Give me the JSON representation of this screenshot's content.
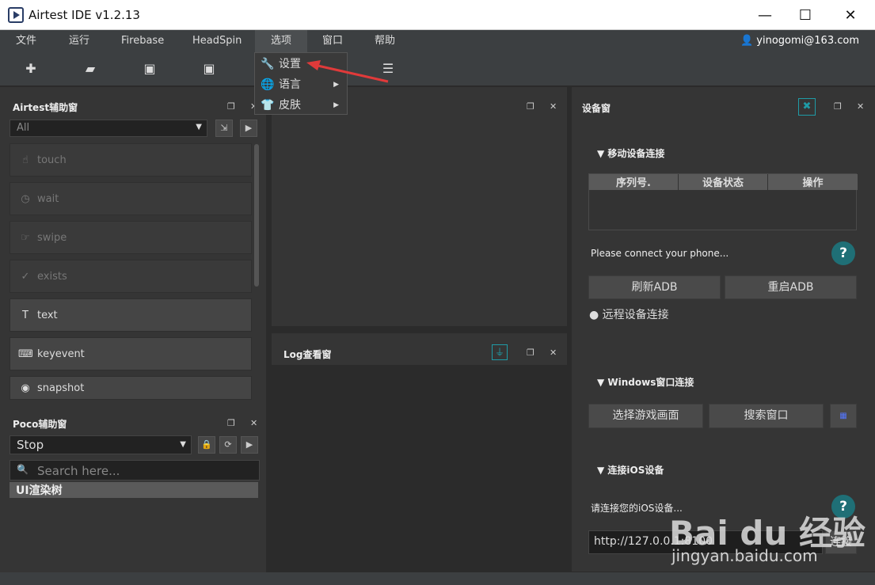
{
  "app": {
    "title": "Airtest IDE v1.2.13"
  },
  "window_controls": [
    "—",
    "☐",
    "✕"
  ],
  "menubar": {
    "items": [
      "文件",
      "运行",
      "Firebase",
      "HeadSpin",
      "选项",
      "窗口",
      "帮助"
    ],
    "user": "yinogomi@163.com"
  },
  "options_menu": {
    "items": [
      {
        "label": "设置",
        "icon": "wrench-icon"
      },
      {
        "label": "语言",
        "icon": "globe-icon"
      },
      {
        "label": "皮肤",
        "icon": "shirt-icon"
      }
    ]
  },
  "airtest_panel": {
    "title": "Airtest辅助窗",
    "mode": "All",
    "actions": [
      {
        "label": "touch",
        "enabled": false
      },
      {
        "label": "wait",
        "enabled": false
      },
      {
        "label": "swipe",
        "enabled": false
      },
      {
        "label": "exists",
        "enabled": false
      },
      {
        "label": "text",
        "enabled": true
      },
      {
        "label": "keyevent",
        "enabled": true
      },
      {
        "label": "snapshot",
        "enabled": true
      }
    ]
  },
  "poco_panel": {
    "title": "Poco辅助窗",
    "mode": "Stop",
    "search_placeholder": "Search here...",
    "tree_root": "UI渲染树"
  },
  "log_panel": {
    "title": "Log查看窗"
  },
  "device_panel": {
    "title": "设备窗",
    "mobile_section": "移动设备连接",
    "table_headers": [
      "序列号.",
      "设备状态",
      "操作"
    ],
    "connect_hint": "Please connect your phone...",
    "refresh_adb": "刷新ADB",
    "restart_adb": "重启ADB",
    "remote_connect": "远程设备连接",
    "windows_section": "Windows窗口连接",
    "select_game": "选择游戏画面",
    "search_window": "搜索窗口",
    "ios_section": "连接iOS设备",
    "ios_hint": "请连接您的iOS设备...",
    "ios_url": "http://127.0.0.1:8100",
    "connect_btn": "连接"
  },
  "watermark": {
    "brand": "Bai du 经验",
    "url": "jingyan.baidu.com"
  },
  "colors": {
    "accent": "#1f6f76",
    "arrow": "#e03a3a"
  }
}
